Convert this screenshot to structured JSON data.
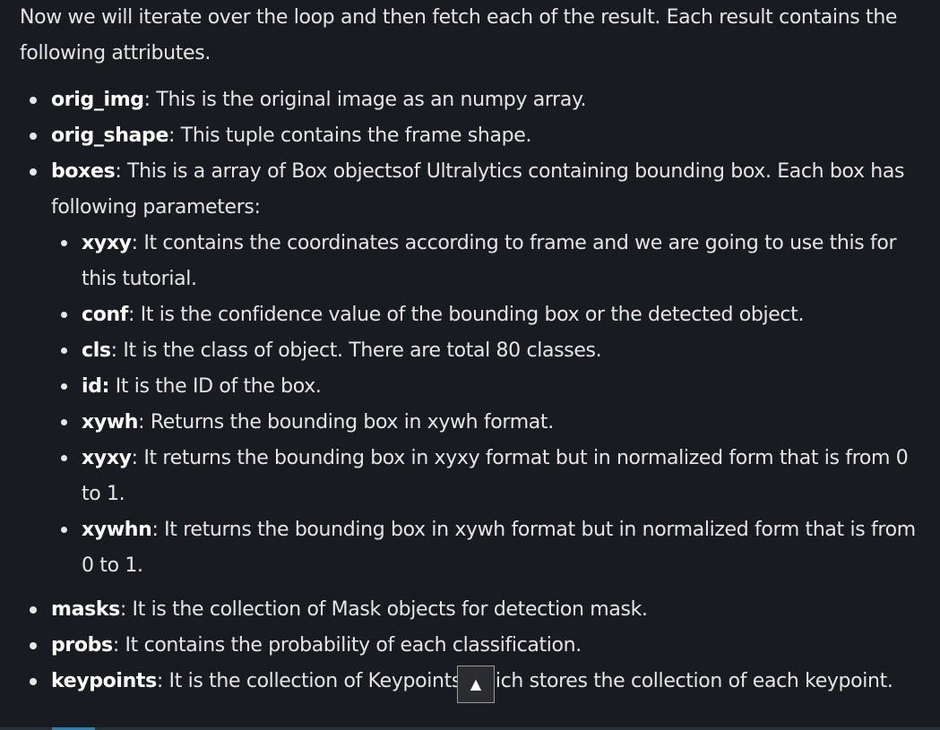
{
  "intro": "Now we will iterate over the loop and then fetch each of the result. Each result contains the following attributes.",
  "items": [
    {
      "term": "orig_img",
      "sep": ":",
      "desc": " This is the original image as an numpy array."
    },
    {
      "term": "orig_shape",
      "sep": ":",
      "desc": " This tuple contains the frame shape."
    },
    {
      "term": "boxes",
      "sep": ":",
      "desc": " This is a array of Box objectsof Ultralytics containing bounding box. Each box has following parameters:"
    },
    {
      "term": "masks",
      "sep": ":",
      "desc": " It is the collection of Mask objects for detection mask."
    },
    {
      "term": "probs",
      "sep": ":",
      "desc": " It contains the probability of each classification."
    },
    {
      "term": "keypoints",
      "sep": ":",
      "desc": " It is the collection of Keypoints which stores the collection of each keypoint."
    }
  ],
  "box_params": [
    {
      "term": "xyxy",
      "sep": ":",
      "desc": " It contains the coordinates according to frame and we are going to use this for this tutorial."
    },
    {
      "term": "conf",
      "sep": ":",
      "desc": " It is the confidence value of the bounding box or the detected object."
    },
    {
      "term": "cls",
      "sep": ":",
      "desc": " It is the class of object. There are total 80 classes."
    },
    {
      "term": "id:",
      "sep": "",
      "desc": " It is the ID of the box."
    },
    {
      "term": "xywh",
      "sep": ":",
      "desc": " Returns the bounding box in xywh format."
    },
    {
      "term": "xyxy",
      "sep": ":",
      "desc": " It returns the bounding box in xyxy format but in normalized form that is from 0 to 1."
    },
    {
      "term": "xywhn",
      "sep": ":",
      "desc": " It returns the bounding box in xywh format but in normalized form that is from 0 to 1."
    }
  ],
  "scroll_top_icon": "▲",
  "icons": {
    "scroll_top": "arrow-up-icon"
  }
}
